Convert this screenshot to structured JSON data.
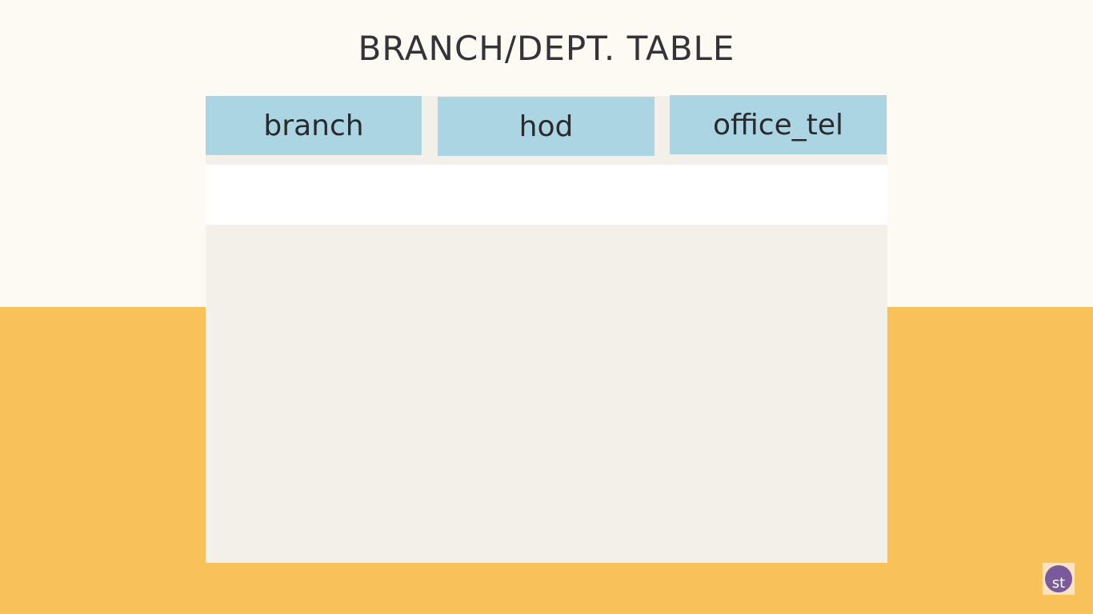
{
  "slide": {
    "title": "BRANCH/DEPT. TABLE"
  },
  "table": {
    "columns": [
      "branch",
      "hod",
      "office_tel"
    ],
    "rows": []
  },
  "logo": {
    "text": "st"
  },
  "colors": {
    "background_top": "#fdf9f3",
    "background_bottom": "#f8c15a",
    "card": "#f3efe9",
    "header_cell": "#abd5e2",
    "row": "#ffffff",
    "text": "#333338"
  }
}
